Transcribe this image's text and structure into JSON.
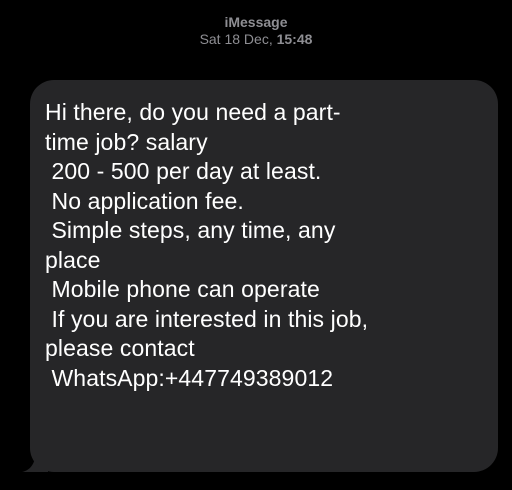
{
  "header": {
    "service": "iMessage",
    "day_date": "Sat 18 Dec,",
    "time": "15:48"
  },
  "message": {
    "lines": [
      "Hi there, do you need a part-",
      "time job? salary",
      " 200 - 500 per day at least.",
      " No application fee.",
      " Simple steps, any time, any",
      "place",
      " Mobile phone can operate",
      " If you are interested in this job,",
      "please contact",
      " WhatsApp:+447749389012"
    ]
  },
  "colors": {
    "background": "#000000",
    "bubble": "#262628",
    "header_text": "#8e8e93",
    "message_text": "#ffffff"
  }
}
